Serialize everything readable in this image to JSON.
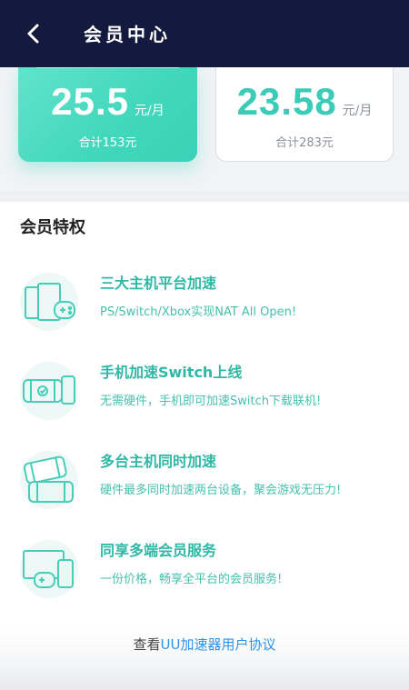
{
  "header": {
    "title": "会员中心",
    "back_icon": "chevron-left-icon"
  },
  "plans": [
    {
      "price": "25.5",
      "unit": "元/月",
      "total": "合计153元",
      "selected": true
    },
    {
      "price": "23.58",
      "unit": "元/月",
      "total": "合计283元",
      "selected": false
    }
  ],
  "privileges": {
    "title": "会员特权",
    "items": [
      {
        "icon": "console-gamepad-icon",
        "title": "三大主机平台加速",
        "desc": "PS/Switch/Xbox实现NAT All Open!"
      },
      {
        "icon": "switch-phone-icon",
        "title": "手机加速Switch上线",
        "desc": "无需硬件，手机即可加速Switch下载联机!"
      },
      {
        "icon": "multi-console-icon",
        "title": "多台主机同时加速",
        "desc": "硬件最多同时加速两台设备，聚会游戏无压力!"
      },
      {
        "icon": "multi-device-icon",
        "title": "同享多端会员服务",
        "desc": "一份价格，畅享全平台的会员服务!"
      }
    ]
  },
  "footer": {
    "prefix": "查看",
    "link": "UU加速器用户协议"
  },
  "colors": {
    "accent": "#43d8bd",
    "header_bg": "#141a3d",
    "link": "#2c93e8"
  }
}
